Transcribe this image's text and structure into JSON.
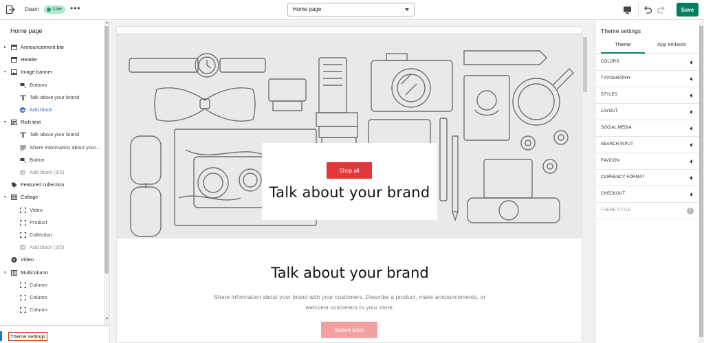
{
  "topbar": {
    "theme_name": "Dawn",
    "status": "Live",
    "more": "•••",
    "page_select": "Home page",
    "save_label": "Save"
  },
  "sidebar": {
    "title": "Home page",
    "rows": [
      {
        "kind": "section",
        "label": "Announcement bar",
        "icon": "section-icon",
        "chevron": "▸"
      },
      {
        "kind": "section",
        "label": "Header",
        "icon": "header-icon",
        "chevron": ""
      },
      {
        "kind": "section",
        "label": "Image banner",
        "icon": "image-icon",
        "chevron": "▾"
      },
      {
        "kind": "child",
        "label": "Buttons",
        "icon": "buttons-icon"
      },
      {
        "kind": "child",
        "label": "Talk about your brand",
        "icon": "text-icon"
      },
      {
        "kind": "add",
        "label": "Add block"
      },
      {
        "kind": "section",
        "label": "Rich text",
        "icon": "richtext-icon",
        "chevron": "▾"
      },
      {
        "kind": "child",
        "label": "Talk about your brand",
        "icon": "text-icon"
      },
      {
        "kind": "child",
        "label": "Share information about your...",
        "icon": "paragraph-icon"
      },
      {
        "kind": "child",
        "label": "Button",
        "icon": "buttons-icon"
      },
      {
        "kind": "add-disabled",
        "label": "Add block (3/3)"
      },
      {
        "kind": "section",
        "label": "Featured collection",
        "icon": "tag-icon",
        "chevron": ""
      },
      {
        "kind": "section",
        "label": "Collage",
        "icon": "collage-icon",
        "chevron": "▾"
      },
      {
        "kind": "child",
        "label": "Video",
        "icon": "block-icon"
      },
      {
        "kind": "child",
        "label": "Product",
        "icon": "block-icon"
      },
      {
        "kind": "child",
        "label": "Collection",
        "icon": "block-icon"
      },
      {
        "kind": "add-disabled",
        "label": "Add block (3/3)"
      },
      {
        "kind": "section",
        "label": "Video",
        "icon": "play-icon",
        "chevron": ""
      },
      {
        "kind": "section",
        "label": "Multicolumn",
        "icon": "columns-icon",
        "chevron": "▾"
      },
      {
        "kind": "child",
        "label": "Column",
        "icon": "block-icon"
      },
      {
        "kind": "child",
        "label": "Column",
        "icon": "block-icon"
      },
      {
        "kind": "child",
        "label": "Column",
        "icon": "block-icon"
      }
    ],
    "theme_settings": "Theme settings"
  },
  "preview": {
    "banner_button": "Shop all",
    "banner_heading": "Talk about your brand",
    "rich_heading": "Talk about your brand",
    "rich_text": "Share information about your brand with your customers. Describe a product, make announcements, or welcome customers to your store.",
    "rich_button": "Button label"
  },
  "settings": {
    "title": "Theme settings",
    "tabs": [
      {
        "label": "Theme",
        "active": true
      },
      {
        "label": "App embeds",
        "active": false
      }
    ],
    "groups": [
      "COLORS",
      "TYPOGRAPHY",
      "STYLES",
      "LAYOUT",
      "SOCIAL MEDIA",
      "SEARCH INPUT",
      "FAVICON",
      "CURRENCY FORMAT",
      "CHECKOUT"
    ],
    "theme_style": "THEME STYLE",
    "info": "!"
  },
  "colors": {
    "accent": "#008060",
    "live_bg": "#aee9d1",
    "shop_button": "#e4373c",
    "link": "#2c6ecb"
  }
}
